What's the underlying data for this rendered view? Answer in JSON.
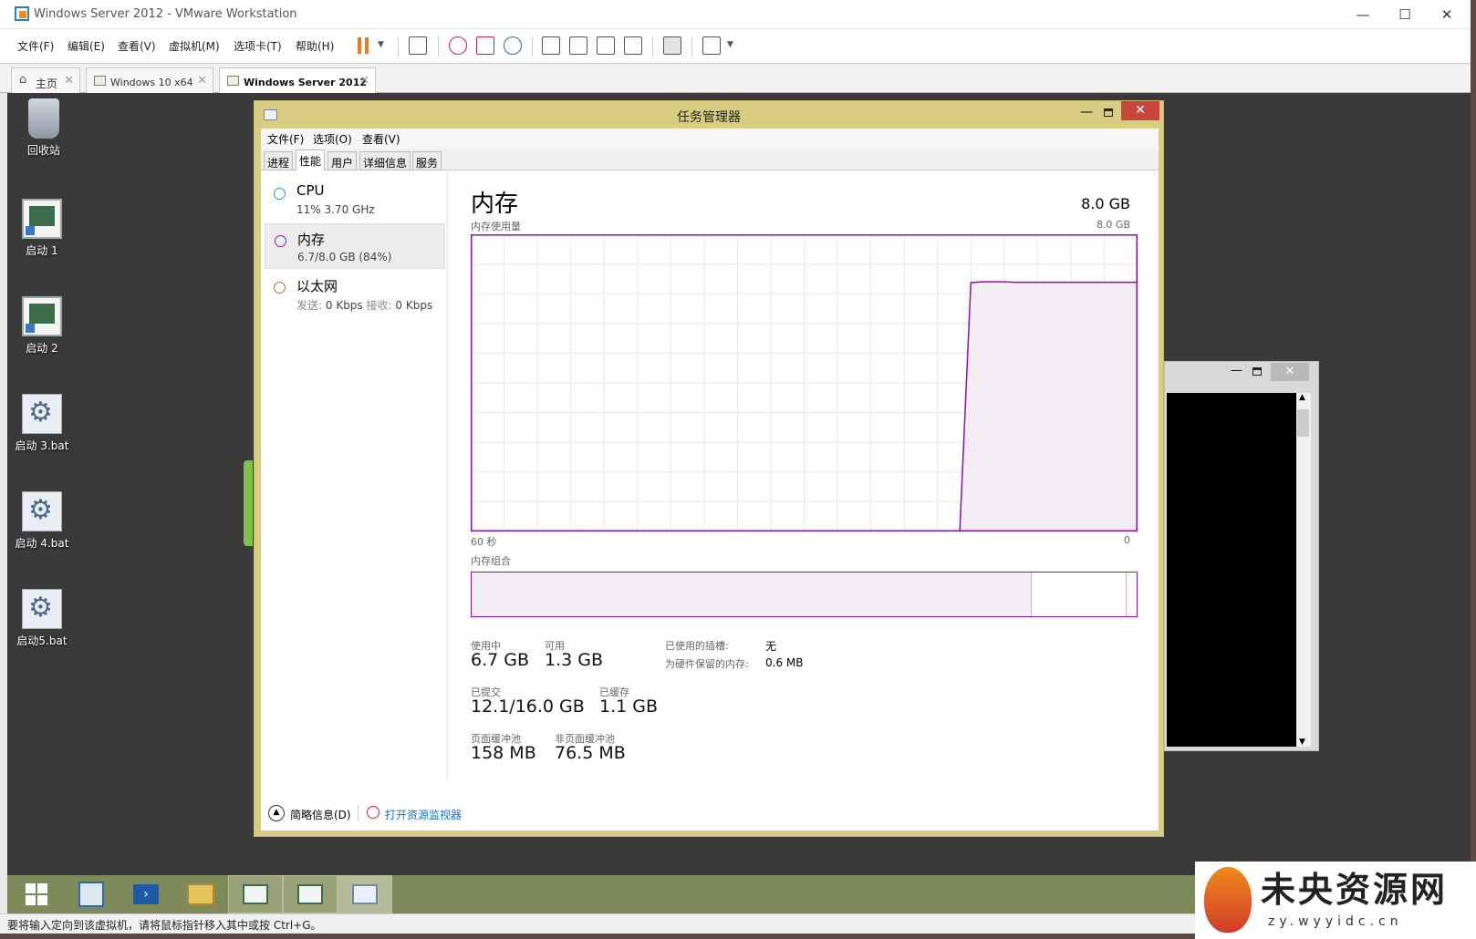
{
  "window": {
    "title": "Windows Server 2012 - VMware Workstation"
  },
  "vm_menu": [
    "文件(F)",
    "编辑(E)",
    "查看(V)",
    "虚拟机(M)",
    "选项卡(T)",
    "帮助(H)"
  ],
  "vm_tabs": [
    "主页",
    "Windows 10 x64",
    "Windows Server 2012"
  ],
  "desktop_icons": [
    "回收站",
    "启动 1",
    "启动 2",
    "启动 3.bat",
    "启动 4.bat",
    "启动5.bat"
  ],
  "tm": {
    "title": "任务管理器",
    "menu": [
      "文件(F)",
      "选项(O)",
      "查看(V)"
    ],
    "tabs": [
      "进程",
      "性能",
      "用户",
      "详细信息",
      "服务"
    ],
    "side": [
      {
        "name": "CPU",
        "sub": "11%  3.70 GHz",
        "color": "#3c8dd6"
      },
      {
        "name": "内存",
        "sub": "6.7/8.0 GB (84%)",
        "color": "#8b12ae"
      },
      {
        "name": "以太网",
        "sub_send_label": "发送:",
        "sub_send": "0 Kbps",
        "sub_recv_label": "接收:",
        "sub_recv": "0 Kbps",
        "color": "#c36a2e"
      }
    ],
    "memory": {
      "heading": "内存",
      "total": "8.0 GB",
      "usage_label": "内存使用量",
      "usage_max": "8.0 GB",
      "axis_left": "60 秒",
      "axis_right": "0",
      "composition_label": "内存组合",
      "in_use_label": "使用中",
      "in_use": "6.7 GB",
      "available_label": "可用",
      "available": "1.3 GB",
      "slots_label": "已使用的插槽:",
      "slots": "无",
      "reserved_label": "为硬件保留的内存:",
      "reserved": "0.6 MB",
      "committed_label": "已提交",
      "committed": "12.1/16.0 GB",
      "cached_label": "已缓存",
      "cached": "1.1 GB",
      "paged_label": "页面缓冲池",
      "paged": "158 MB",
      "nonpaged_label": "非页面缓冲池",
      "nonpaged": "76.5 MB"
    },
    "footer": {
      "summary": "简略信息(D)",
      "monitor": "打开资源监视器"
    }
  },
  "chart_data": {
    "type": "area",
    "title": "内存使用量",
    "ylim": [
      0,
      8.0
    ],
    "x_label_left": "60 秒",
    "x_label_right": "0",
    "series": [
      {
        "values": [
          0,
          0,
          0,
          0,
          0,
          0,
          0,
          0,
          0,
          0,
          0,
          0,
          0,
          0,
          0,
          0,
          0,
          0,
          0,
          0,
          0,
          0,
          0,
          0,
          0,
          0,
          0,
          0,
          0,
          0,
          0,
          0,
          0,
          0,
          0,
          0,
          0,
          0,
          0,
          0,
          0,
          0,
          0,
          0,
          0,
          6.7,
          6.72,
          6.72,
          6.72,
          6.71,
          6.71,
          6.71,
          6.71,
          6.71,
          6.71,
          6.71,
          6.71,
          6.71,
          6.71,
          6.71,
          6.71
        ],
        "color": "#8b12ae"
      }
    ]
  },
  "composition": {
    "in_use_fraction": 0.843,
    "standby_fraction": 0.143,
    "free_fraction": 0.014
  },
  "status": "要将输入定向到该虚拟机，请将鼠标指针移入其中或按 Ctrl+G。",
  "watermark": {
    "cn": "未央资源网",
    "en": "zy.wyyidc.cn"
  }
}
